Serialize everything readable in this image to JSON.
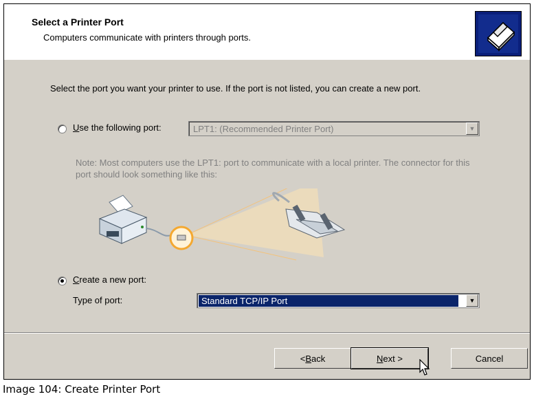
{
  "header": {
    "title": "Select a Printer Port",
    "subtitle": "Computers communicate with printers through ports."
  },
  "intro": "Select the port you want your printer to use.  If the port is not listed, you can create a new port.",
  "use_port": {
    "label": "Use the following port:",
    "accelerator": "U",
    "label_rest": "se the following port:",
    "selected": false,
    "value": "LPT1: (Recommended Printer Port)"
  },
  "note": "Note: Most computers use the LPT1: port to communicate with a local printer. The connector for this port should look something like this:",
  "create_port": {
    "label": "Create a new port:",
    "accelerator": "C",
    "label_rest": "reate a new port:",
    "selected": true,
    "type_label": "Type of port:",
    "type_value": "Standard TCP/IP Port"
  },
  "buttons": {
    "back": {
      "prefix": "< ",
      "accelerator": "B",
      "rest": "ack"
    },
    "next": {
      "accelerator": "N",
      "rest": "ext >"
    },
    "cancel": "Cancel"
  },
  "caption": "Image 104: Create Printer Port",
  "colors": {
    "dialog_bg": "#d4d0c8",
    "selection": "#0a246a",
    "header_icon_bg": "#0a1f7a"
  },
  "icons": [
    "printer-icon",
    "parallel-connector-icon",
    "radio-button",
    "dropdown-arrow",
    "mouse-cursor"
  ]
}
